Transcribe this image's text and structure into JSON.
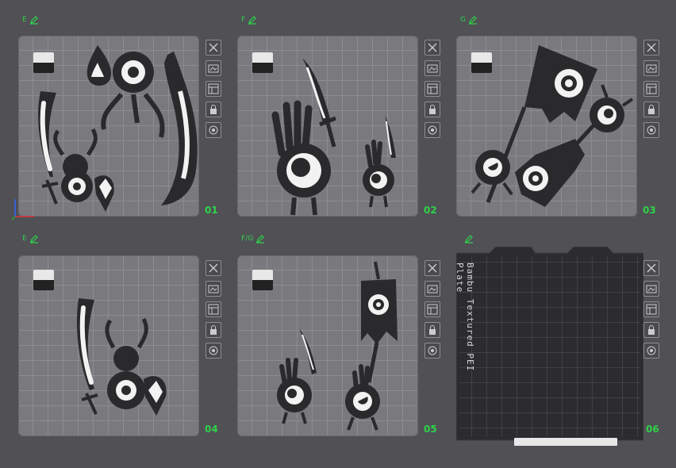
{
  "colors": {
    "accent": "#2fd24a",
    "plate": "#7a7a7e",
    "art": "#2a2a2c",
    "art_light": "#f2f2f2"
  },
  "plates": [
    {
      "label": "E",
      "number": "01"
    },
    {
      "label": "F",
      "number": "02"
    },
    {
      "label": "G",
      "number": "03"
    },
    {
      "label": "E",
      "number": "04"
    },
    {
      "label": "F/G",
      "number": "05"
    },
    {
      "label": "",
      "number": "06"
    }
  ],
  "texture_plate": {
    "text": "Bambu Textured PEI Plate"
  },
  "tool_icons": [
    "close-icon",
    "auto-orient-icon",
    "arrange-icon",
    "lock-icon",
    "settings-icon"
  ]
}
